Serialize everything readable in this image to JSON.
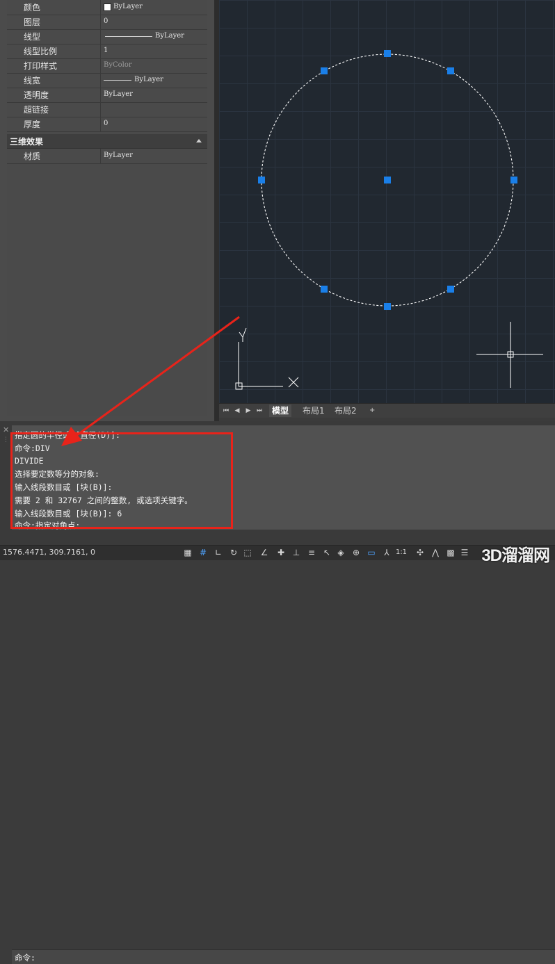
{
  "properties": {
    "general_rows": [
      {
        "name": "颜色",
        "value": "ByLayer"
      },
      {
        "name": "图层",
        "value": "0"
      },
      {
        "name": "线型",
        "value": "ByLayer"
      },
      {
        "name": "线型比例",
        "value": "1"
      },
      {
        "name": "打印样式",
        "value": "ByColor"
      },
      {
        "name": "线宽",
        "value": "ByLayer"
      },
      {
        "name": "透明度",
        "value": "ByLayer"
      },
      {
        "name": "超链接",
        "value": ""
      },
      {
        "name": "厚度",
        "value": "0"
      }
    ],
    "section_3d": "三维效果",
    "rows_3d": [
      {
        "name": "材质",
        "value": "ByLayer"
      }
    ]
  },
  "layout_tabs": {
    "model": "模型",
    "layout1": "布局1",
    "layout2": "布局2",
    "add": "+"
  },
  "ucs": {
    "y_label": "Y"
  },
  "command_window": {
    "lines": [
      "指定圆的半径或 [直径(D)]:",
      "命令:DIV",
      "DIVIDE",
      "选择要定数等分的对象:",
      "输入线段数目或 [块(B)]:",
      "需要 2 和 32767 之间的整数, 或选项关键字。",
      "输入线段数目或 [块(B)]: 6",
      "命令:指定对角点:"
    ],
    "prompt": "命令:"
  },
  "status_bar": {
    "coordinates": "1576.4471, 309.7161, 0",
    "scale": "1:1"
  },
  "watermark": "3D溜溜网",
  "colors": {
    "annotation_red": "#e8231a",
    "grip_blue": "#1a7fe8",
    "canvas_bg": "#212830"
  }
}
